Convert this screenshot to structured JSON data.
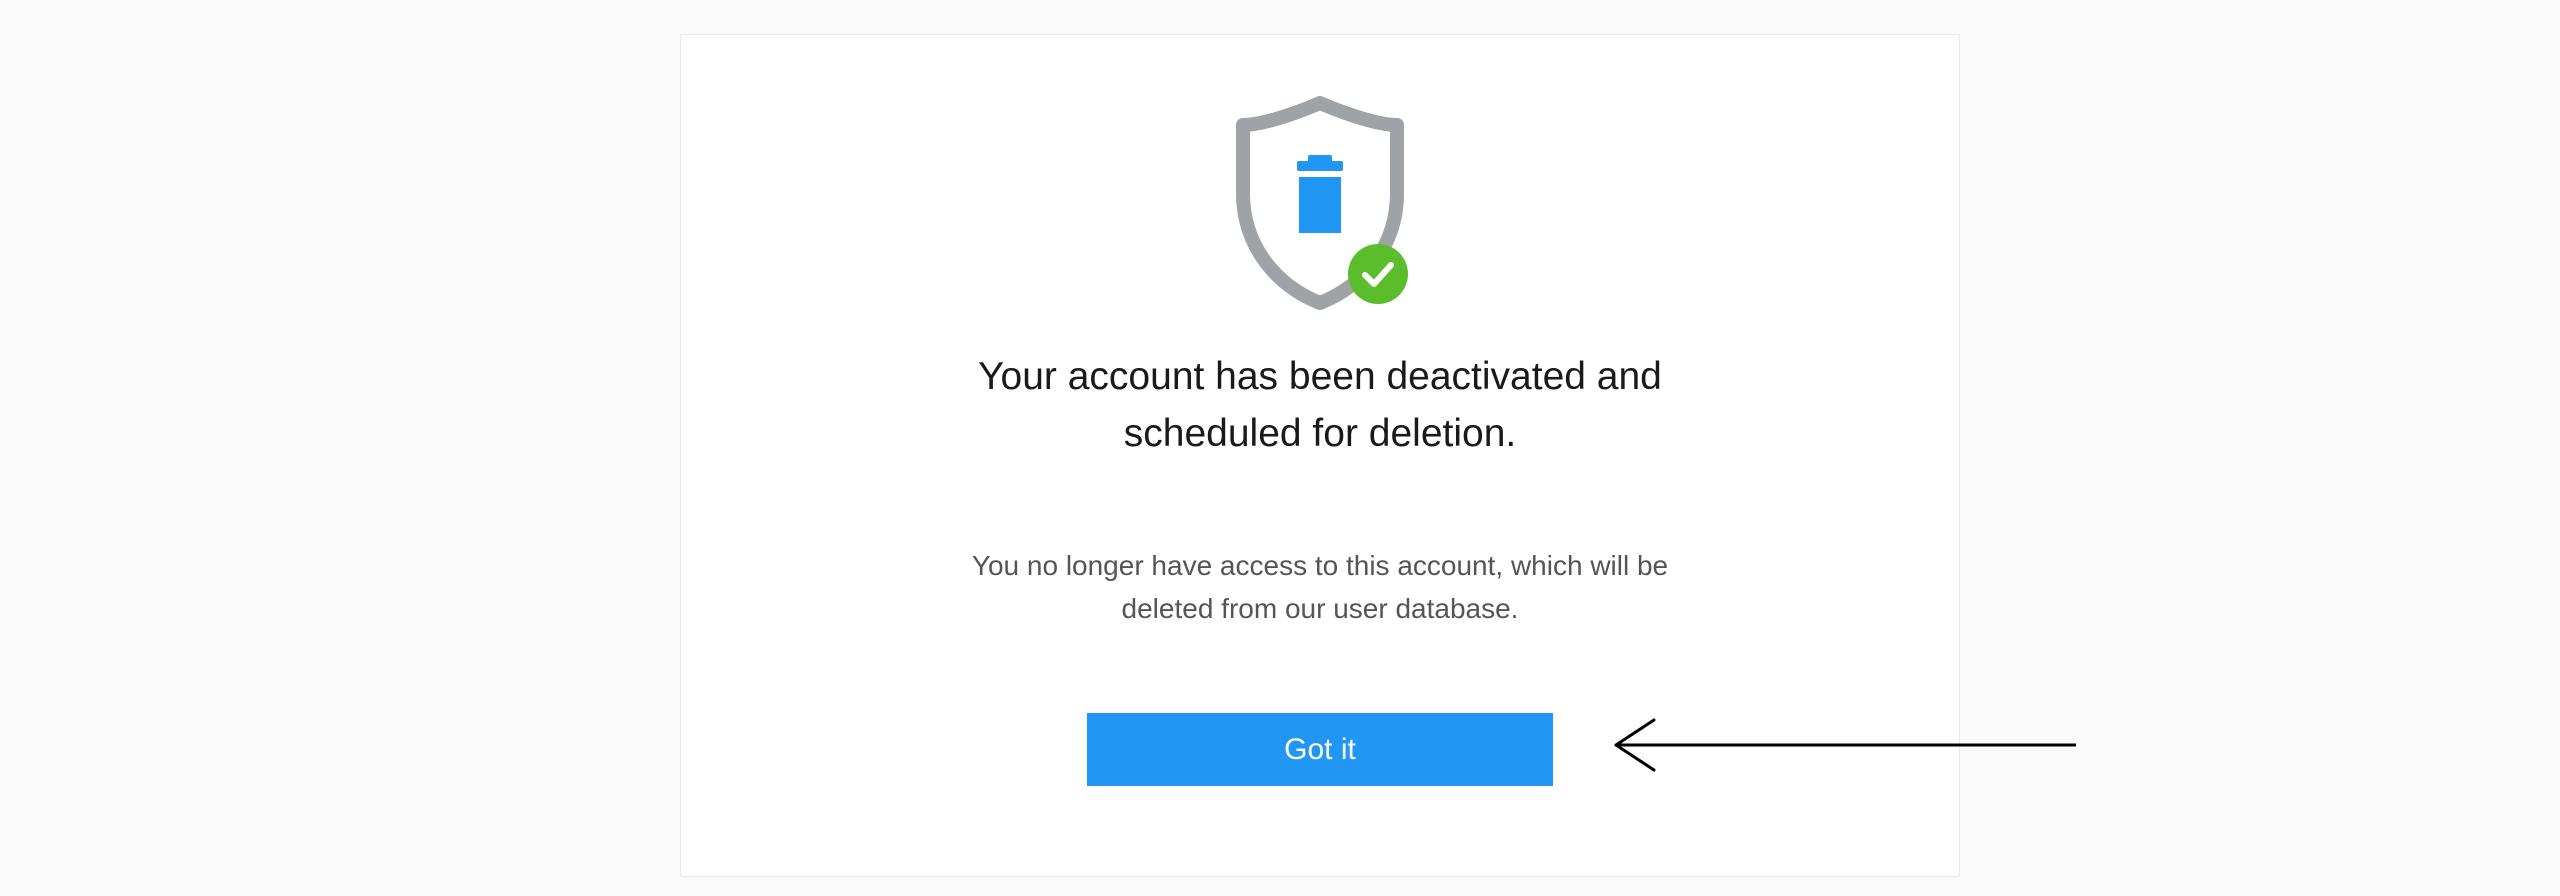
{
  "icons": {
    "main": "shield-trash-icon",
    "badge": "check-circle-icon"
  },
  "dialog": {
    "title": "Your account has been deactivated and scheduled for deletion.",
    "subtitle": "You no longer have access to this account, which will be deleted from our user database.",
    "confirm_label": "Got it"
  },
  "colors": {
    "accent": "#2196f3",
    "success": "#5bbd2b",
    "shield_outline": "#9fa3a7"
  },
  "annotation": {
    "arrow": "pointer-arrow"
  }
}
